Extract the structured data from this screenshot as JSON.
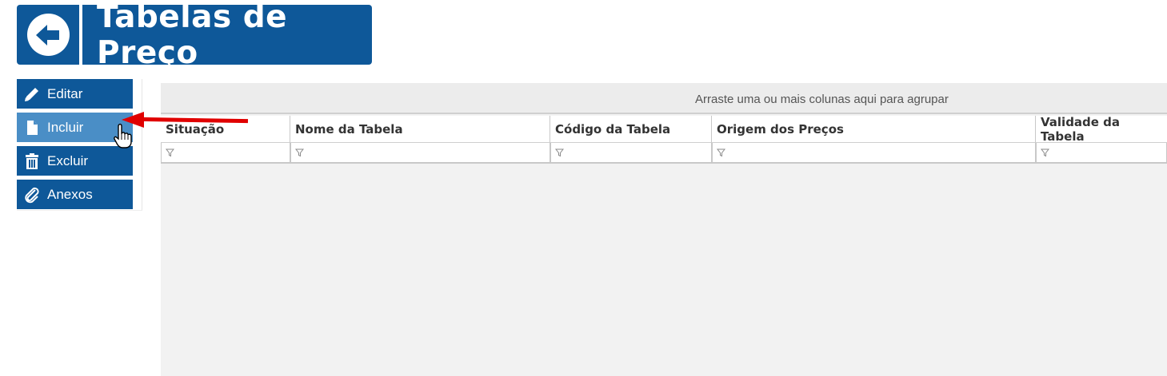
{
  "header": {
    "title": "Tabelas de Preço",
    "back_icon": "arrow-left-circle-icon",
    "color": "#0e5899"
  },
  "sidebar": {
    "items": [
      {
        "label": "Editar",
        "icon": "pencil-icon"
      },
      {
        "label": "Incluir",
        "icon": "file-icon",
        "state": "hover"
      },
      {
        "label": "Excluir",
        "icon": "trash-icon"
      },
      {
        "label": "Anexos",
        "icon": "paperclip-icon"
      }
    ]
  },
  "grid": {
    "group_panel_text": "Arraste uma ou mais colunas aqui para agrupar",
    "columns": [
      {
        "label": "Situação"
      },
      {
        "label": "Nome da Tabela"
      },
      {
        "label": "Código da Tabela"
      },
      {
        "label": "Origem dos Preços"
      },
      {
        "label": "Validade da Tabela"
      }
    ],
    "filter_icon": "filter-icon",
    "rows": []
  },
  "annotation": {
    "arrow_color": "#e00000",
    "cursor_icon": "hand-pointer-icon"
  }
}
